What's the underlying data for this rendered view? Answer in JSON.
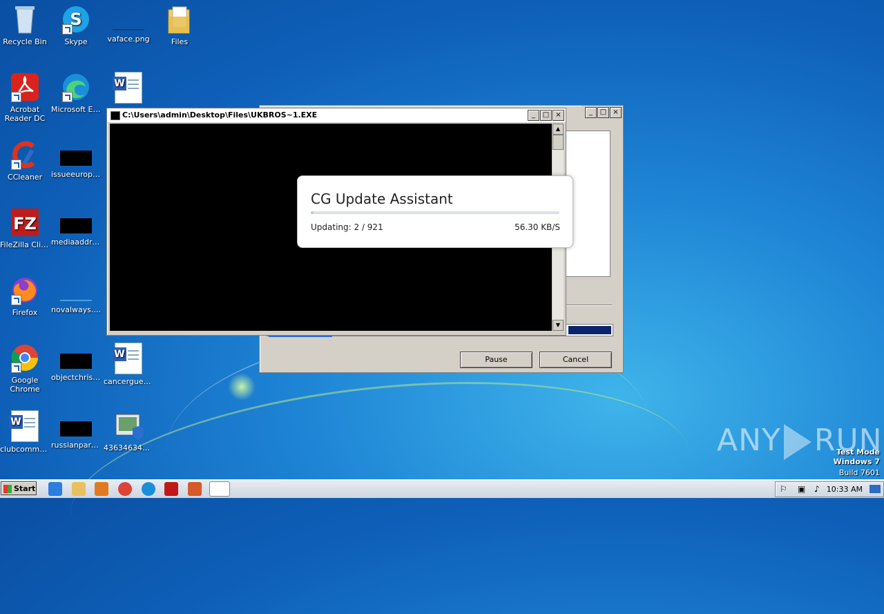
{
  "desktop": {
    "icons": [
      {
        "label": "Recycle Bin",
        "icon": "recycle-bin-icon"
      },
      {
        "label": "Skype",
        "icon": "skype-icon"
      },
      {
        "label": "vaface.png",
        "icon": "image-file-icon"
      },
      {
        "label": "Files",
        "icon": "folder-icon"
      },
      {
        "label": "Acrobat Reader DC",
        "icon": "acrobat-icon"
      },
      {
        "label": "Microsoft Edge",
        "icon": "edge-icon"
      },
      {
        "label": "",
        "icon": "word-doc-icon"
      },
      {
        "label": "CCleaner",
        "icon": "ccleaner-icon"
      },
      {
        "label": "issueeurope...",
        "icon": "file-icon"
      },
      {
        "label": "FileZilla Client",
        "icon": "filezilla-icon"
      },
      {
        "label": "mediaaddre...",
        "icon": "file-icon"
      },
      {
        "label": "Firefox",
        "icon": "firefox-icon"
      },
      {
        "label": "novalways....",
        "icon": "file-icon"
      },
      {
        "label": "Google Chrome",
        "icon": "chrome-icon"
      },
      {
        "label": "objectchrist...",
        "icon": "file-icon"
      },
      {
        "label": "cancergues...",
        "icon": "word-doc-icon"
      },
      {
        "label": "clubcomma...",
        "icon": "word-doc-icon"
      },
      {
        "label": "russianpare...",
        "icon": "file-icon"
      },
      {
        "label": "436346346...",
        "icon": "installer-icon"
      }
    ]
  },
  "console": {
    "title": "C:\\Users\\admin\\Desktop\\Files\\UKBROS~1.EXE",
    "min": "_",
    "max": "□",
    "close": "×"
  },
  "installer": {
    "pause_label": "Pause",
    "cancel_label": "Cancel"
  },
  "popup": {
    "title": "CG Update Assistant",
    "status": "Updating: 2 / 921",
    "speed": "56.30 KB/S",
    "progress": 0.002
  },
  "watermark": {
    "brand_left": "ANY",
    "brand_right": "RUN",
    "mode": "Test Mode",
    "os": "Windows 7",
    "build": "Build 7601"
  },
  "taskbar": {
    "start_label": "Start",
    "clock": "10:33 AM"
  },
  "colors": {
    "desktop": "#1f86d6",
    "titlebar": "#0a246a"
  }
}
